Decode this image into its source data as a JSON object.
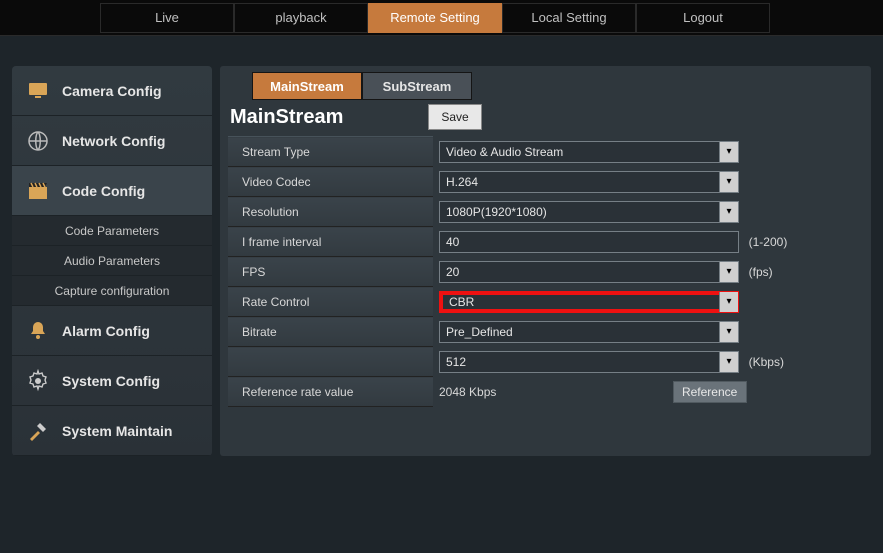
{
  "topnav": {
    "items": [
      {
        "label": "Live"
      },
      {
        "label": "playback"
      },
      {
        "label": "Remote Setting",
        "active": true
      },
      {
        "label": "Local Setting"
      },
      {
        "label": "Logout"
      }
    ]
  },
  "sidebar": {
    "items": [
      {
        "label": "Camera Config",
        "icon": "monitor-icon"
      },
      {
        "label": "Network Config",
        "icon": "globe-icon"
      },
      {
        "label": "Code Config",
        "icon": "clapper-icon",
        "active": true,
        "subs": [
          "Code Parameters",
          "Audio Parameters",
          "Capture configuration"
        ]
      },
      {
        "label": "Alarm Config",
        "icon": "bell-icon"
      },
      {
        "label": "System Config",
        "icon": "gear-icon"
      },
      {
        "label": "System Maintain",
        "icon": "tools-icon"
      }
    ]
  },
  "stream_tabs": {
    "main": "MainStream",
    "sub": "SubStream"
  },
  "page": {
    "heading": "MainStream",
    "save_label": "Save"
  },
  "form": {
    "stream_type": {
      "label": "Stream Type",
      "value": "Video & Audio Stream"
    },
    "video_codec": {
      "label": "Video Codec",
      "value": "H.264"
    },
    "resolution": {
      "label": "Resolution",
      "value": "1080P(1920*1080)"
    },
    "iframe": {
      "label": "I frame interval",
      "value": "40",
      "hint": "(1-200)"
    },
    "fps": {
      "label": "FPS",
      "value": "20",
      "unit": "(fps)"
    },
    "rate_control": {
      "label": "Rate Control",
      "value": "CBR"
    },
    "bitrate_mode": {
      "label": "Bitrate",
      "value": "Pre_Defined"
    },
    "bitrate": {
      "value": "512",
      "unit": "(Kbps)"
    },
    "reference": {
      "label": "Reference rate value",
      "value": "2048 Kbps",
      "button": "Reference"
    }
  }
}
